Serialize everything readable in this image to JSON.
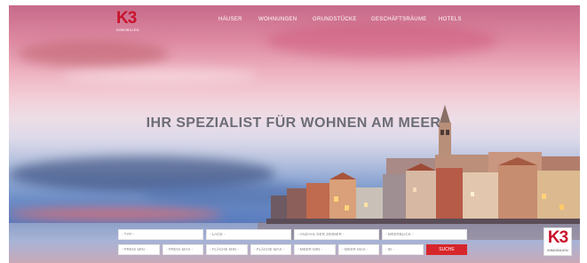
{
  "brand": {
    "logo_mark": "K3",
    "logo_sub": "IMMOBILIEN"
  },
  "nav": {
    "items": [
      {
        "label": "HÄUSER"
      },
      {
        "label": "WOHNUNGEN"
      },
      {
        "label": "GRUNDSTÜCKE"
      },
      {
        "label": "GESCHÄFTSRÄUME"
      },
      {
        "label": "HOTELS"
      }
    ]
  },
  "hero": {
    "headline": "IHR SPEZIALIST FÜR WOHNEN AM MEER"
  },
  "search": {
    "row1": [
      {
        "placeholder": "- TYP -"
      },
      {
        "placeholder": "- LAGE -"
      },
      {
        "placeholder": "- ANZAHL DER ZIMMER -"
      },
      {
        "placeholder": "- MEERBLICK -"
      }
    ],
    "row2": [
      {
        "placeholder": "- PREIS MIN -"
      },
      {
        "placeholder": "- PREIS MAX -"
      },
      {
        "placeholder": "- FLÄCHE MIN -"
      },
      {
        "placeholder": "- FLÄCHE MAX -"
      },
      {
        "placeholder": "- MEER MIN -"
      },
      {
        "placeholder": "- MEER MAX -"
      },
      {
        "placeholder": "- ID -"
      }
    ],
    "button_label": "SUCHE"
  },
  "colors": {
    "accent": "#d7262b",
    "logo_red": "#c8142c",
    "headline": "#6d6e77"
  }
}
